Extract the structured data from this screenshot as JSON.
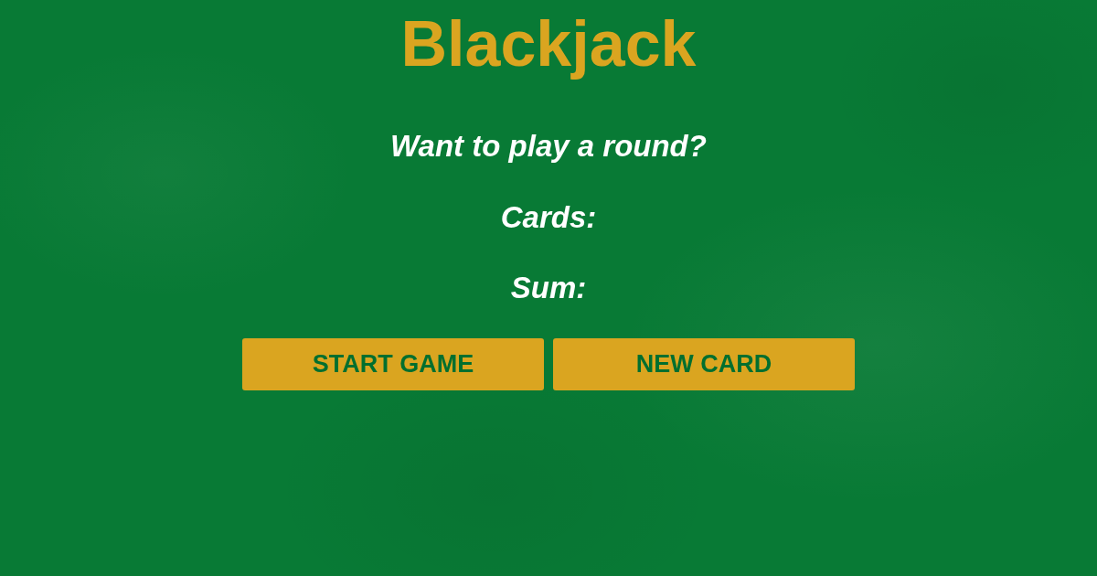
{
  "title": "Blackjack",
  "message": "Want to play a round?",
  "cards": {
    "label": "Cards:"
  },
  "sum": {
    "label": "Sum:"
  },
  "buttons": [
    {
      "label": "START GAME"
    },
    {
      "label": "NEW CARD"
    }
  ]
}
